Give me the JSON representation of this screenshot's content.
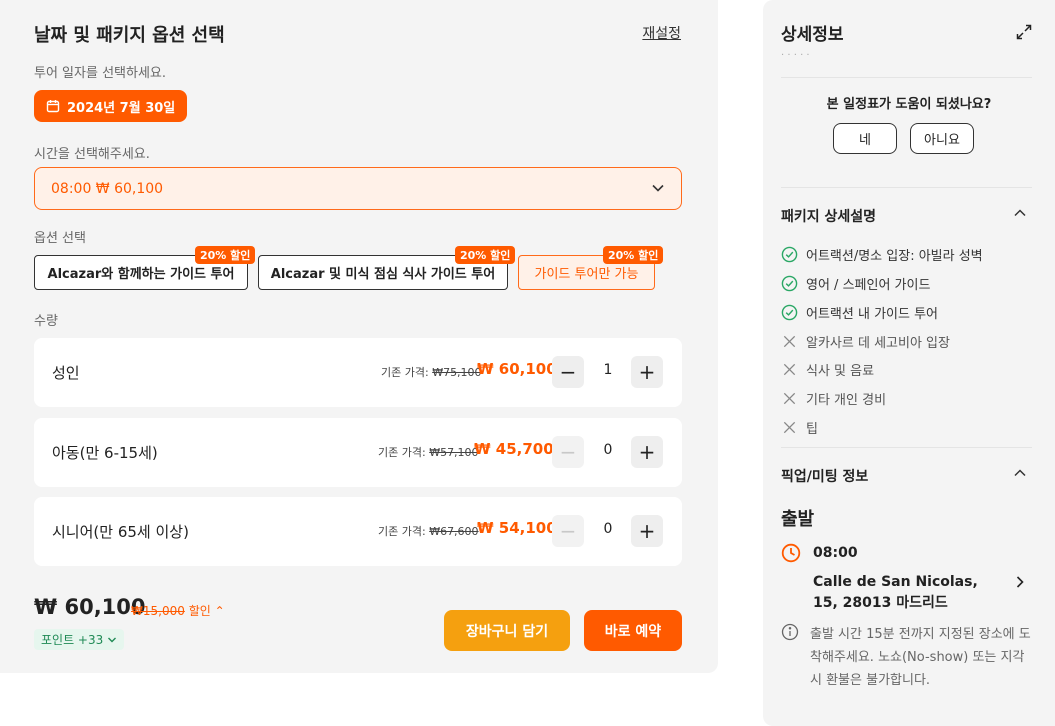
{
  "left": {
    "title": "날짜 및 패키지 옵션 선택",
    "reset_label": "재설정",
    "date_label": "투어 일자를 선택하세요.",
    "date_value": "2024년 7월 30일",
    "time_label": "시간을 선택해주세요.",
    "time_value": "08:00 ₩ 60,100",
    "option_label": "옵션 선택",
    "options": [
      {
        "label": "Alcazar와 함께하는 가이드 투어",
        "badge": "20% 할인",
        "selected": false
      },
      {
        "label": "Alcazar 및 미식 점심 식사 가이드 투어",
        "badge": "20% 할인",
        "selected": false
      },
      {
        "label": "가이드 투어만 가능",
        "badge": "20% 할인",
        "selected": true
      }
    ],
    "qty_label": "수량",
    "rows": [
      {
        "name": "성인",
        "orig_prefix": "기존 가격:",
        "orig_price": "₩75,100",
        "price": "₩ 60,100",
        "qty": "1",
        "minus_enabled": true
      },
      {
        "name": "아동(만 6-15세)",
        "orig_prefix": "기존 가격:",
        "orig_price": "₩57,100",
        "price": "₩ 45,700",
        "qty": "0",
        "minus_enabled": false
      },
      {
        "name": "시니어(만 65세 이상)",
        "orig_prefix": "기존 가격:",
        "orig_price": "₩67,600",
        "price": "₩ 54,100",
        "qty": "0",
        "minus_enabled": false
      }
    ],
    "total": "₩ 60,100",
    "discount_amount": "₩15,000",
    "discount_text": "할인",
    "points": "포인트 +33",
    "cart_label": "장바구니 담기",
    "book_label": "바로 예약"
  },
  "right": {
    "title": "상세정보",
    "cut_text": "· · · · ·",
    "question": "본 일정표가 도움이 되셨나요?",
    "yes_label": "네",
    "no_label": "아니요",
    "package_heading": "패키지 상세설명",
    "included": [
      "어트랙션/명소 입장: 아빌라 성벽",
      "영어 / 스페인어 가이드",
      "어트랙션 내 가이드 투어"
    ],
    "excluded": [
      "알카사르 데 세고비아 입장",
      "식사 및 음료",
      "기타 개인 경비",
      "팁"
    ],
    "pickup_heading": "픽업/미팅 정보",
    "departure_label": "출발",
    "departure_time": "08:00",
    "address": "Calle de San Nicolas, 15, 28013 마드리드",
    "note": "출발 시간 15분 전까지 지정된 장소에 도착해주세요. 노쇼(No-show) 또는 지각시 환불은 불가합니다."
  },
  "colors": {
    "accent": "#ff5a00",
    "cart": "#f5a00f",
    "success": "#2aa765",
    "panel": "#f4f4f4"
  },
  "icons": [
    "calendar-icon",
    "chevron-down-icon",
    "minus-icon",
    "plus-icon",
    "expand-icon",
    "check-circle-icon",
    "x-icon",
    "chevron-up-icon",
    "clock-icon",
    "chevron-right-icon",
    "info-icon"
  ]
}
